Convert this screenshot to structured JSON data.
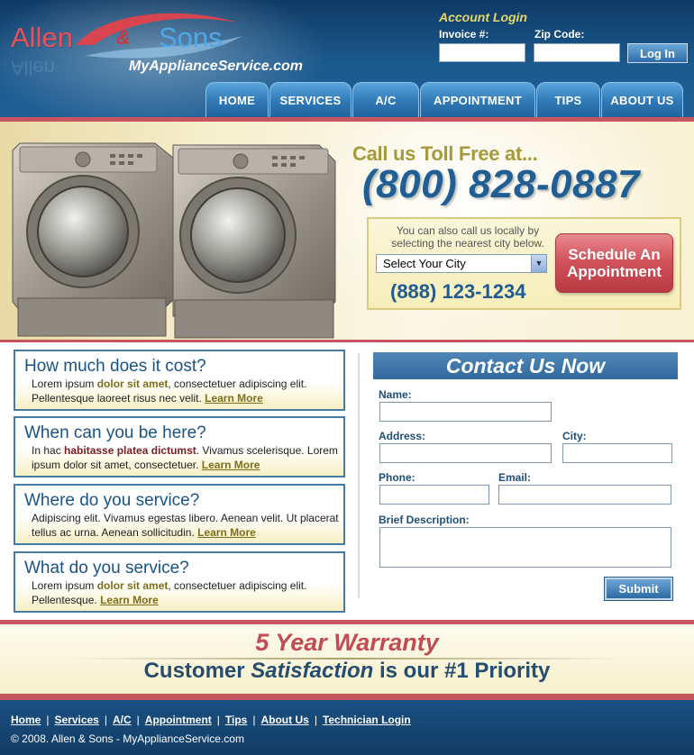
{
  "logo": {
    "word1": "Allen",
    "amp": "&",
    "word2": "Sons",
    "domain": "MyApplianceService.com"
  },
  "login": {
    "title": "Account Login",
    "invoice_label": "Invoice #:",
    "zip_label": "Zip Code:",
    "invoice_value": "",
    "zip_value": "",
    "button": "Log In"
  },
  "nav": {
    "items": [
      {
        "label": "HOME"
      },
      {
        "label": "SERVICES"
      },
      {
        "label": "A/C"
      },
      {
        "label": "APPOINTMENT"
      },
      {
        "label": "TIPS"
      },
      {
        "label": "ABOUT US"
      }
    ]
  },
  "hero": {
    "call_title": "Call us Toll Free at...",
    "toll_free": "(800) 828-0887",
    "local_text": "You can also call us locally by selecting the nearest city below.",
    "city_select": "Select Your City",
    "local_number": "(888) 123-1234",
    "schedule_button": "Schedule An Appointment"
  },
  "faq": [
    {
      "question": "How much does it cost?",
      "a1": "Lorem ipsum ",
      "hl": "dolor sit amet",
      "a2": ", consectetuer adipiscing elit. Pellentesque laoreet risus nec velit.",
      "link": "Learn More"
    },
    {
      "question": "When can you be here?",
      "a1": "In hac ",
      "hl": "habitasse platea dictumst",
      "a2": ". Vivamus scelerisque. Lorem ipsum dolor sit amet, consectetuer.",
      "link": "Learn More"
    },
    {
      "question": "Where do you service?",
      "a1": "Adipiscing elit. Vivamus egestas libero. Aenean velit. Ut placerat tellus ac urna. Aenean sollicitudin.",
      "hl": "",
      "a2": "",
      "link": "Learn More"
    },
    {
      "question": "What do you service?",
      "a1": "Lorem ipsum ",
      "hl": "dolor sit amet",
      "a2": ", consectetuer adipiscing elit. Pellentesque.",
      "link": "Learn More"
    }
  ],
  "contact": {
    "title": "Contact Us Now",
    "name_label": "Name:",
    "address_label": "Address:",
    "city_label": "City:",
    "phone_label": "Phone:",
    "email_label": "Email:",
    "description_label": "Brief Description:",
    "submit": "Submit"
  },
  "warranty": {
    "title": "5 Year Warranty",
    "sub_a": "Customer ",
    "sub_b": "Satisfaction",
    "sub_c": " is our ",
    "sub_d": "#1 Priority"
  },
  "footer": {
    "links": [
      {
        "label": "Home"
      },
      {
        "label": "Services"
      },
      {
        "label": "A/C"
      },
      {
        "label": "Appointment"
      },
      {
        "label": "Tips"
      },
      {
        "label": "About Us"
      },
      {
        "label": "Technician Login"
      }
    ],
    "copyright": "© 2008. Allen & Sons - MyApplianceService.com"
  },
  "colors": {
    "header_blue": "#1b5a8e",
    "accent_red": "#c65560",
    "gold": "#7d6f1a",
    "toll_free_blue": "#1f5f96"
  }
}
